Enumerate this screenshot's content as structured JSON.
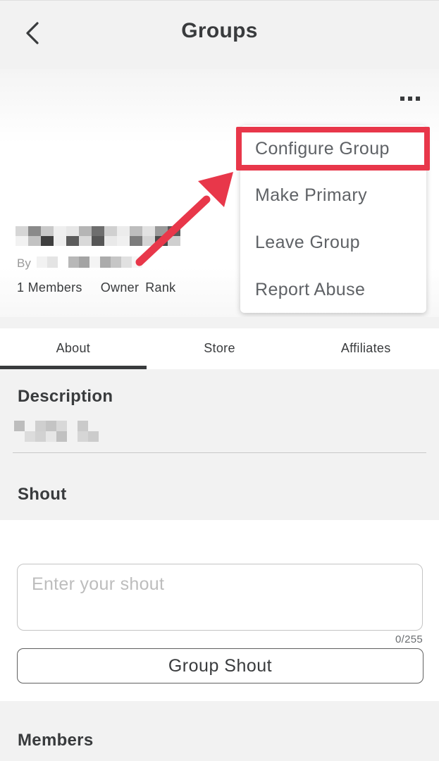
{
  "header": {
    "title": "Groups",
    "back_icon": "chevron-left-icon"
  },
  "group": {
    "owner_prefix": "By",
    "members_text": "1 Members",
    "rank_label": "Owner",
    "rank_suffix": "Rank",
    "more_icon": "more-horizontal-icon"
  },
  "menu": {
    "items": [
      {
        "label": "Configure Group"
      },
      {
        "label": "Make Primary"
      },
      {
        "label": "Leave Group"
      },
      {
        "label": "Report Abuse"
      }
    ],
    "highlight_color": "#e8374a"
  },
  "tabs": [
    {
      "label": "About",
      "active": true
    },
    {
      "label": "Store",
      "active": false
    },
    {
      "label": "Affiliates",
      "active": false
    }
  ],
  "description": {
    "title": "Description"
  },
  "shout": {
    "title": "Shout",
    "placeholder": "Enter your shout",
    "value": "",
    "char_count": "0/255",
    "button_label": "Group Shout"
  },
  "members": {
    "title": "Members"
  },
  "colors": {
    "text": "#393b3d",
    "section_bg": "#f2f2f2",
    "annotation": "#e8374a"
  }
}
